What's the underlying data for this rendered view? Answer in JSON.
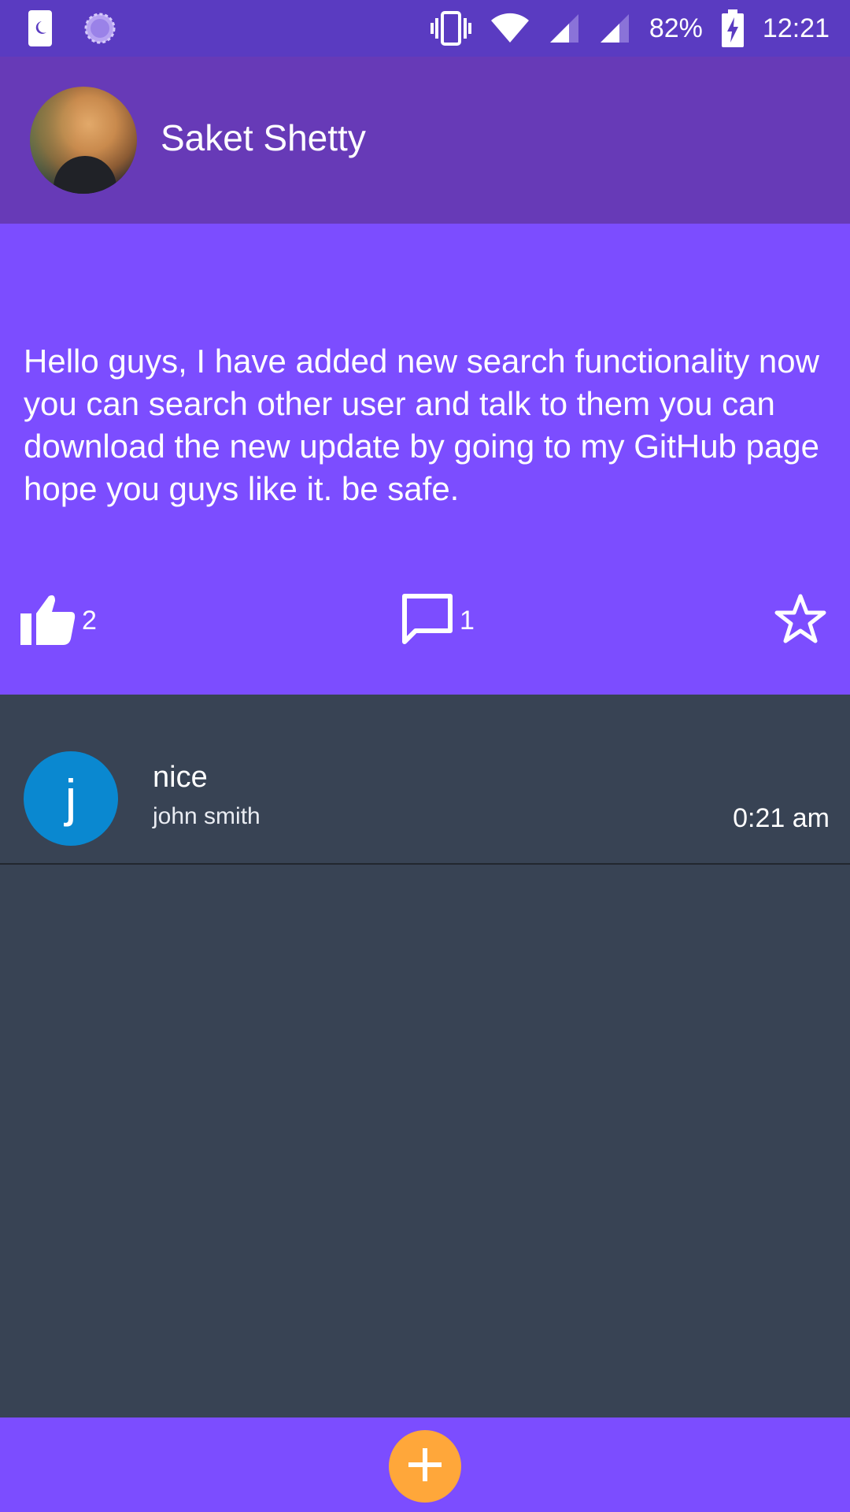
{
  "status_bar": {
    "battery": "82%",
    "time": "12:21",
    "icons": [
      "phone-moon-icon",
      "sync-icon",
      "vibrate-icon",
      "wifi-icon",
      "signal-icon",
      "signal-icon",
      "battery-charging-icon"
    ]
  },
  "header": {
    "user_name": "Saket Shetty"
  },
  "post": {
    "text": "Hello guys, I have added new search functionality now you can search other user and talk to them you can download the new update by going to my GitHub page hope you guys like it. be safe.",
    "likes": "2",
    "comments": "1"
  },
  "comments": [
    {
      "initial": "j",
      "text": "nice",
      "author": "john smith",
      "time": "0:21 am"
    }
  ],
  "colors": {
    "status_bar": "#5a3bc1",
    "header": "#673ab7",
    "post": "#7c4dff",
    "background": "#384354",
    "comment_avatar": "#0a88d0",
    "fab": "#ffa73a"
  }
}
